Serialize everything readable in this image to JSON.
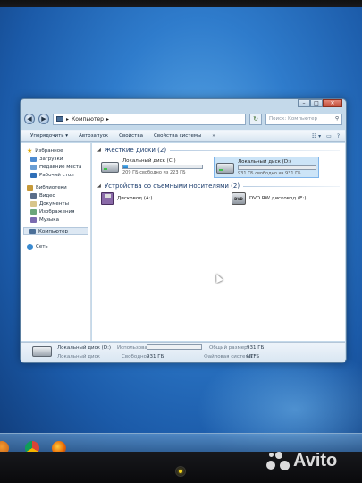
{
  "window": {
    "address": "Компьютер",
    "search_placeholder": "Поиск: Компьютер"
  },
  "toolbar": {
    "organize": "Упорядочить ▾",
    "autoplay": "Автозапуск",
    "properties": "Свойства",
    "system_properties": "Свойства системы",
    "more": "»"
  },
  "nav": {
    "favorites": "Избранное",
    "downloads": "Загрузки",
    "recent": "Недавние места",
    "desktop": "Рабочий стол",
    "libraries": "Библиотеки",
    "video": "Видео",
    "documents": "Документы",
    "images": "Изображения",
    "music": "Музыка",
    "computer": "Компьютер",
    "network": "Сеть"
  },
  "hdd_group": {
    "title": "Жесткие диски (2)",
    "drives": [
      {
        "name": "Локальный диск (C:)",
        "free_text": "209 ГБ свободно из 223 ГБ",
        "used_fraction": 0.06
      },
      {
        "name": "Локальный диск (D:)",
        "free_text": "931 ГБ свободно из 931 ГБ",
        "used_fraction": 0.0
      }
    ]
  },
  "removable_group": {
    "title": "Устройства со съемными носителями (2)",
    "items": [
      {
        "name": "Дисковод (A:)"
      },
      {
        "name": "DVD RW дисковод (E:)",
        "badge": "DVD"
      }
    ]
  },
  "details": {
    "name": "Локальный диск (D:)",
    "type": "Локальный диск",
    "used_label": "Использовано:",
    "used_fraction": 0.0,
    "free_label": "Свободно:",
    "free_value": "931 ГБ",
    "total_label": "Общий размер:",
    "total_value": "931 ГБ",
    "fs_label": "Файловая система:",
    "fs_value": "NTFS"
  },
  "watermark": {
    "text": "Avito"
  },
  "colors": {
    "wallpaper": "#2f7ccc",
    "window_frame": "#c4d9ea",
    "drive_bar": "#1f7cc9",
    "selection": "#cce4f7"
  }
}
